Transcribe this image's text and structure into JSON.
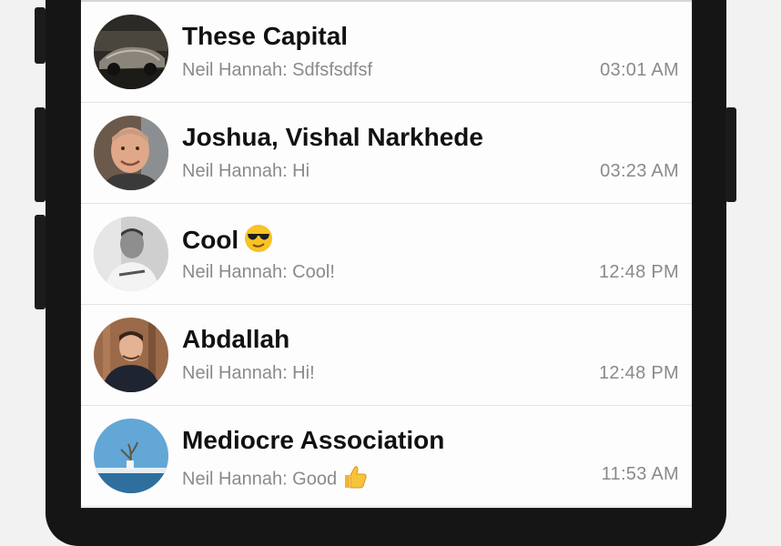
{
  "chats": [
    {
      "title": "These Capital",
      "title_emoji": "",
      "preview": "Neil Hannah: Sdfsfsdfsf",
      "preview_emoji": "",
      "time": "03:01 AM"
    },
    {
      "title": "Joshua, Vishal Narkhede",
      "title_emoji": "",
      "preview": "Neil Hannah: Hi",
      "preview_emoji": "",
      "time": "03:23 AM"
    },
    {
      "title": "Cool",
      "title_emoji": "sunglasses-emoji",
      "preview": "Neil Hannah: Cool!",
      "preview_emoji": "",
      "time": "12:48 PM"
    },
    {
      "title": "Abdallah",
      "title_emoji": "",
      "preview": "Neil Hannah: Hi!",
      "preview_emoji": "",
      "time": "12:48 PM"
    },
    {
      "title": "Mediocre Association",
      "title_emoji": "",
      "preview": "Neil Hannah: Good",
      "preview_emoji": "thumbs-up-emoji",
      "time": "11:53 AM"
    }
  ],
  "colors": {
    "title": "#111111",
    "secondary": "#8a8a8a",
    "divider": "#e3e3e3",
    "device": "#151515"
  }
}
